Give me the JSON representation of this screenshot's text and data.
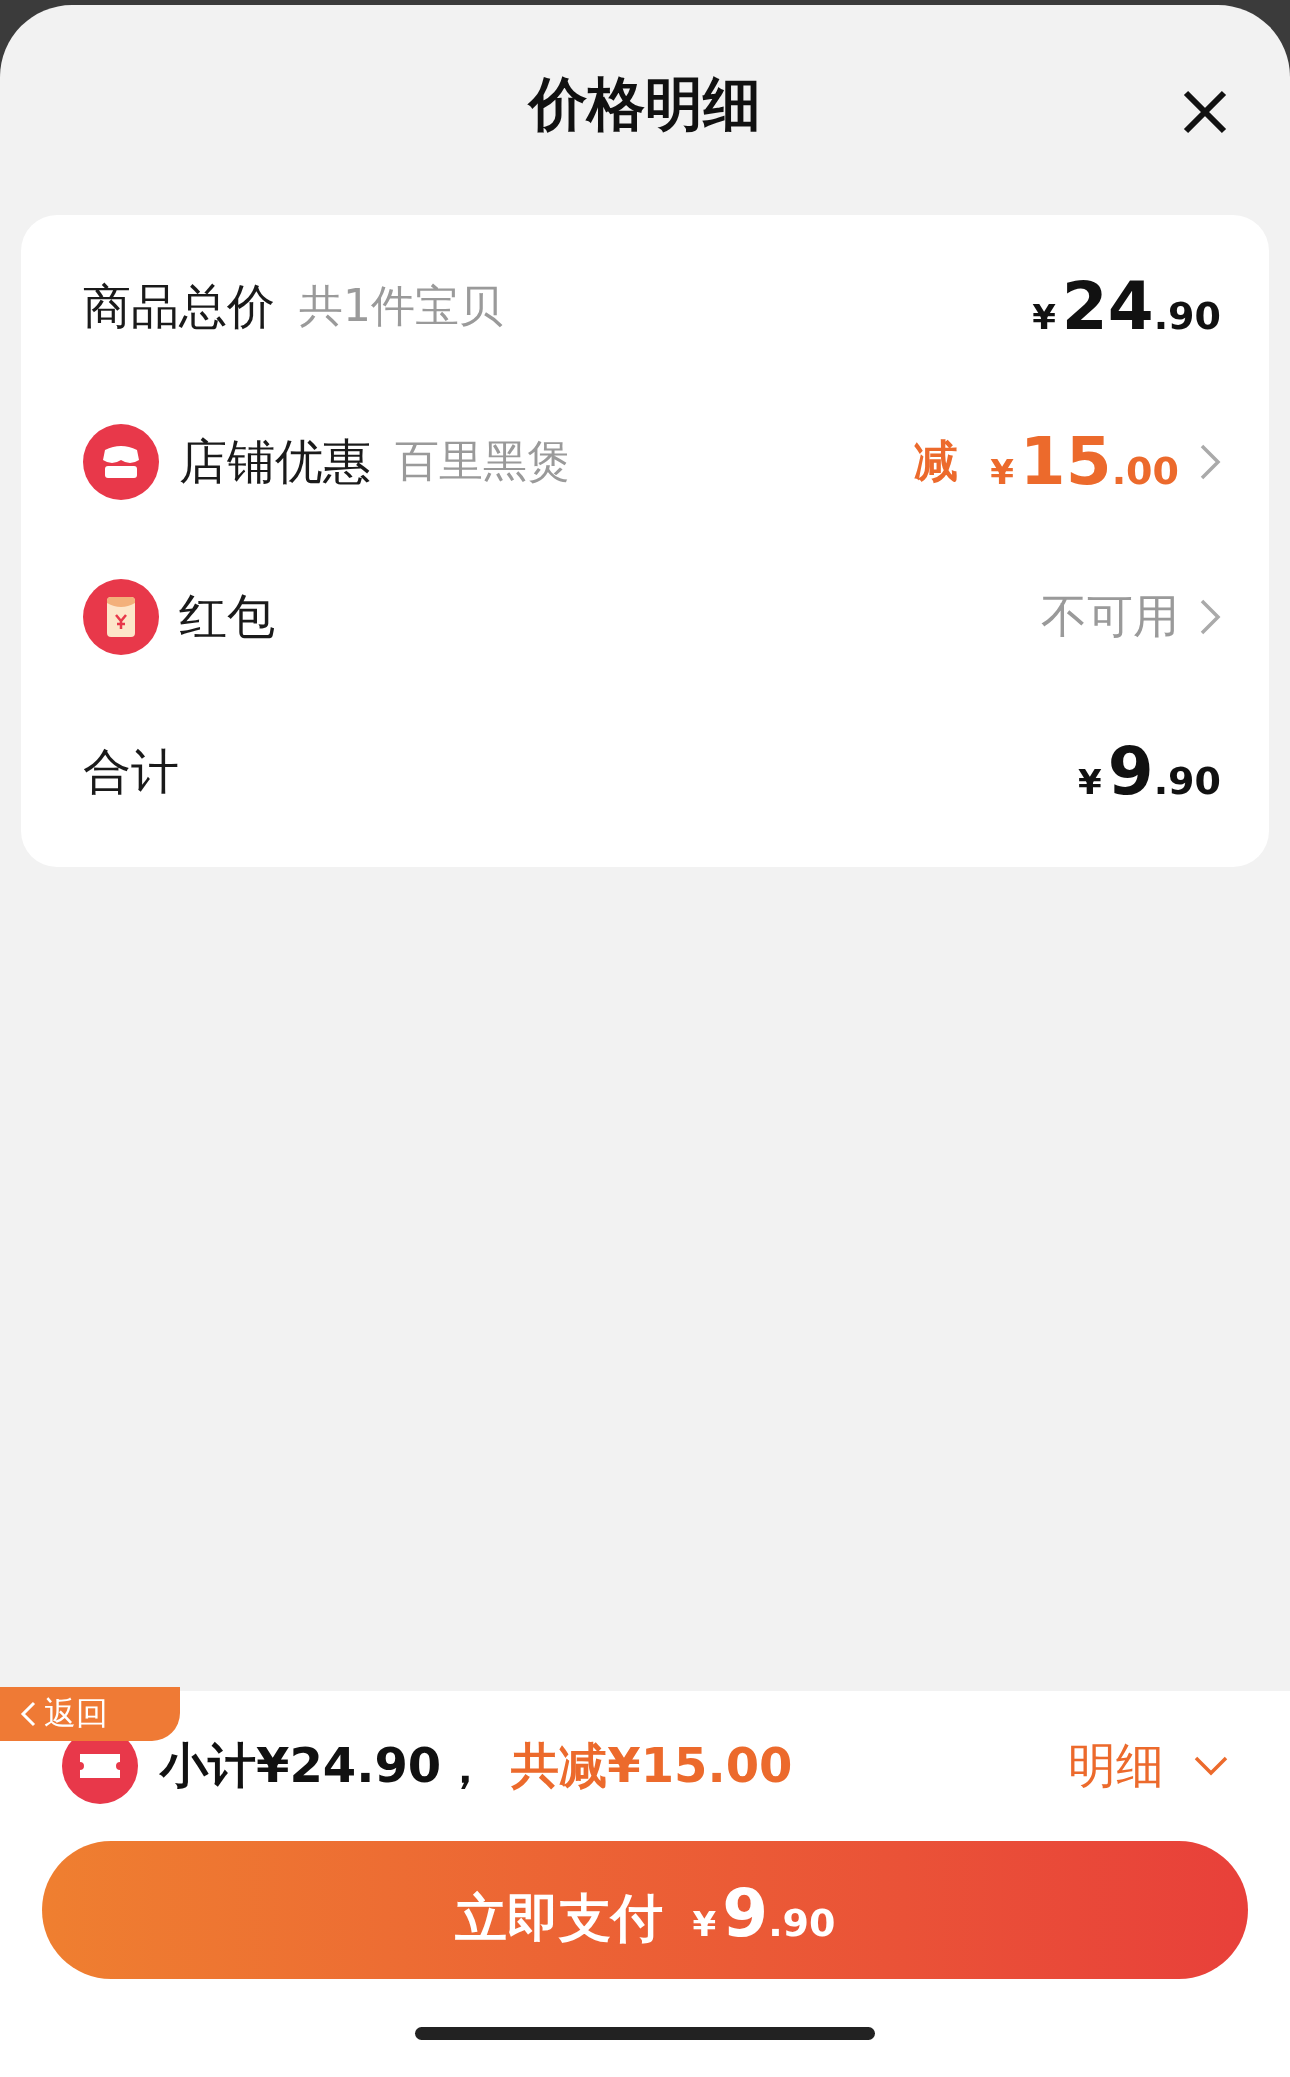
{
  "header": {
    "title": "价格明细"
  },
  "rows": [
    {
      "kind": "total",
      "label": "商品总价",
      "sub": "共1件宝贝",
      "price": {
        "yen": "¥",
        "int": "24",
        "dec": ".90"
      }
    },
    {
      "kind": "discount",
      "label": "店铺优惠",
      "sub": "百里黑煲",
      "prefix": "减",
      "price": {
        "yen": "¥",
        "int": "15",
        "dec": ".00"
      }
    },
    {
      "kind": "status",
      "label": "红包",
      "value": "不可用"
    },
    {
      "kind": "total",
      "label": "合计",
      "price": {
        "yen": "¥",
        "int": "9",
        "dec": ".90"
      }
    }
  ],
  "footer": {
    "back": "返回",
    "subtotal": "小计¥24.90，",
    "saved": "共减¥15.00",
    "details": "明细",
    "pay": {
      "label": "立即支付",
      "yen": "¥",
      "int": "9",
      "dec": ".90"
    }
  }
}
